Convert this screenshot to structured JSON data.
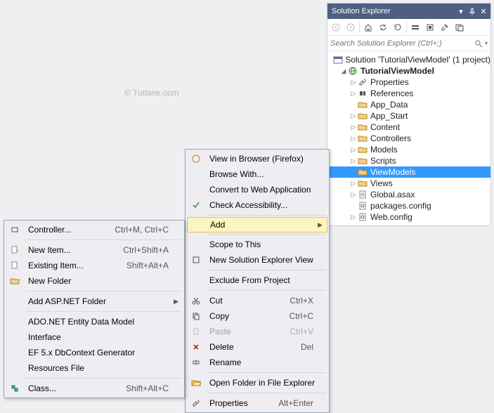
{
  "watermark": "© Tutlane.com",
  "panel": {
    "title": "Solution Explorer",
    "search_placeholder": "Search Solution Explorer (Ctrl+;)"
  },
  "tree": {
    "sln": "Solution 'TutorialViewModel' (1 project)",
    "proj": "TutorialViewModel",
    "items": [
      "Properties",
      "References",
      "App_Data",
      "App_Start",
      "Content",
      "Controllers",
      "Models",
      "Scripts",
      "ViewModels",
      "Views",
      "Global.asax",
      "packages.config",
      "Web.config"
    ]
  },
  "menu2": {
    "view_browser": "View in Browser (Firefox)",
    "browse_with": "Browse With...",
    "convert": "Convert to Web Application",
    "check_access": "Check Accessibility...",
    "add": "Add",
    "scope": "Scope to This",
    "new_sln_view": "New Solution Explorer View",
    "exclude": "Exclude From Project",
    "cut": "Cut",
    "cut_sc": "Ctrl+X",
    "copy": "Copy",
    "copy_sc": "Ctrl+C",
    "paste": "Paste",
    "paste_sc": "Ctrl+V",
    "delete": "Delete",
    "delete_sc": "Del",
    "rename": "Rename",
    "open_folder": "Open Folder in File Explorer",
    "properties": "Properties",
    "properties_sc": "Alt+Enter"
  },
  "menu1": {
    "controller": "Controller...",
    "controller_sc": "Ctrl+M, Ctrl+C",
    "new_item": "New Item...",
    "new_item_sc": "Ctrl+Shift+A",
    "existing_item": "Existing Item...",
    "existing_item_sc": "Shift+Alt+A",
    "new_folder": "New Folder",
    "add_asp": "Add ASP.NET Folder",
    "adonet": "ADO.NET Entity Data Model",
    "interface": "Interface",
    "ef5": "EF 5.x DbContext Generator",
    "resources": "Resources File",
    "class": "Class...",
    "class_sc": "Shift+Alt+C"
  }
}
